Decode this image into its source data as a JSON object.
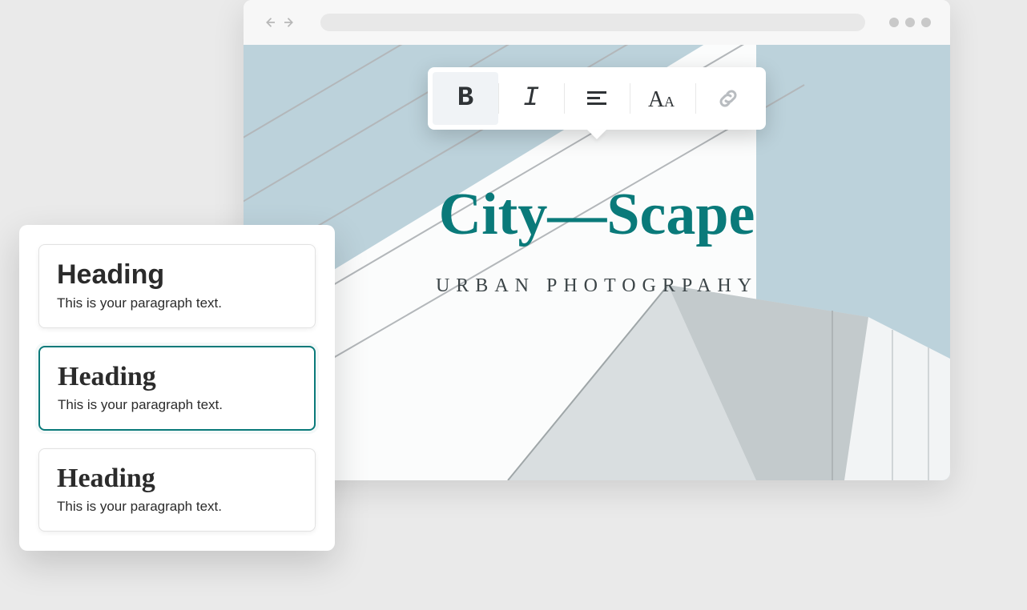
{
  "browser": {
    "nav_back_icon": "arrow-left",
    "nav_forward_icon": "arrow-right",
    "window_dot_icon": "window-dot"
  },
  "toolbar": {
    "bold_label": "B",
    "italic_label": "I",
    "align_icon": "align-left",
    "font_size_icon": "font-size-Aa",
    "link_icon": "link"
  },
  "hero": {
    "title": "City—Scape",
    "subtitle": "URBAN PHOTOGRPAHY"
  },
  "picker": {
    "options": [
      {
        "heading": "Heading",
        "paragraph": "This is your paragraph text.",
        "selected": false,
        "font_class": "font-rounded"
      },
      {
        "heading": "Heading",
        "paragraph": "This is your paragraph text.",
        "selected": true,
        "font_class": "font-slab"
      },
      {
        "heading": "Heading",
        "paragraph": "This is your paragraph text.",
        "selected": false,
        "font_class": "font-serif-contrast"
      }
    ]
  },
  "colors": {
    "accent": "#0a7a7a",
    "bg": "#eaeaea",
    "sky": "#bcd2db"
  }
}
